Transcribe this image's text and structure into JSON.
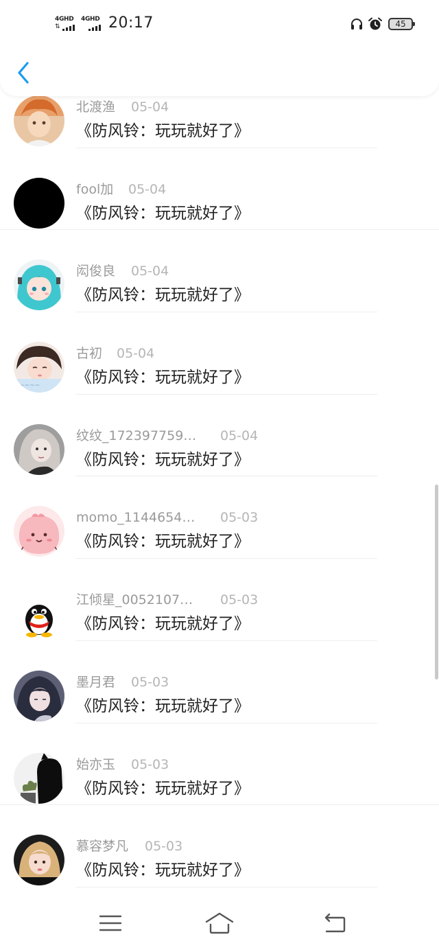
{
  "status_bar": {
    "network_1": "4GHD",
    "network_2": "4GHD",
    "time": "20:17",
    "battery": "45",
    "icons": [
      "signal-icon",
      "signal-icon",
      "headphones-icon",
      "alarm-icon",
      "battery-icon"
    ]
  },
  "nav": {
    "back_icon": "chevron-left-icon",
    "accent_color": "#1a9bf0"
  },
  "comments": [
    {
      "username": "北渡渔",
      "date": "05-04",
      "text": "《防风铃：玩玩就好了》",
      "avatar": "avatar-anime-orange-hair"
    },
    {
      "username": "fool加",
      "date": "05-04",
      "text": "《防风铃：玩玩就好了》",
      "avatar": "avatar-black"
    },
    {
      "username": "闳俊良",
      "date": "05-04",
      "text": "《防风铃：玩玩就好了》",
      "avatar": "avatar-teal-hair-anime"
    },
    {
      "username": "古初",
      "date": "05-04",
      "text": "《防风铃：玩玩就好了》",
      "avatar": "avatar-photo-girl"
    },
    {
      "username": "纹纹_172397759…",
      "date": "05-04",
      "text": "《防风铃：玩玩就好了》",
      "avatar": "avatar-photo-girl-bw"
    },
    {
      "username": "momo_1144654…",
      "date": "05-03",
      "text": "《防风铃：玩玩就好了》",
      "avatar": "avatar-pink-blob"
    },
    {
      "username": "江倾星_0052107…",
      "date": "05-03",
      "text": "《防风铃：玩玩就好了》",
      "avatar": "avatar-penguin"
    },
    {
      "username": "墨月君",
      "date": "05-03",
      "text": "《防风铃：玩玩就好了》",
      "avatar": "avatar-anime-dark"
    },
    {
      "username": "始亦玉",
      "date": "05-03",
      "text": "《防风铃：玩玩就好了》",
      "avatar": "avatar-black-cat"
    },
    {
      "username": "慕容梦凡",
      "date": "05-03",
      "text": "《防风铃：玩玩就好了》",
      "avatar": "avatar-photo-blonde"
    }
  ],
  "bottom_nav": {
    "icons": [
      "menu-icon",
      "home-icon",
      "back-icon"
    ]
  }
}
